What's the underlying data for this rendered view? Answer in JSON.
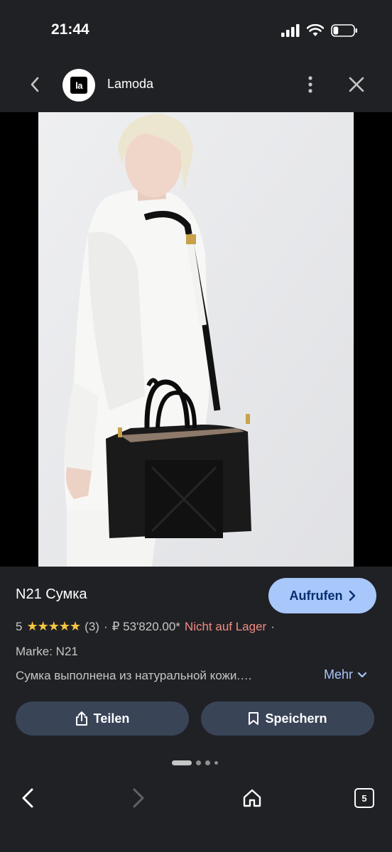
{
  "status_bar": {
    "time": "21:44",
    "battery_level": 0.25
  },
  "header": {
    "site_logo_text": "la",
    "site_name": "Lamoda"
  },
  "product": {
    "title": "N21 Сумка",
    "visit_label": "Aufrufen",
    "rating": "5",
    "stars": "★★★★★",
    "review_count": "(3)",
    "price": "₽ 53'820.00*",
    "availability": "Nicht auf Lager",
    "brand": "Marke: N21",
    "description": "Сумка выполнена из натуральной кожи.…",
    "more_label": "Mehr"
  },
  "actions": {
    "share_label": "Teilen",
    "save_label": "Speichern"
  },
  "carousel": {
    "count": 4,
    "active": 0
  },
  "toolbar": {
    "tab_count": "5"
  },
  "colors": {
    "background": "#202125",
    "accent": "#a8c7fa",
    "button_bg": "#394457",
    "out_of_stock": "#f28b82",
    "star": "#f5c542"
  }
}
